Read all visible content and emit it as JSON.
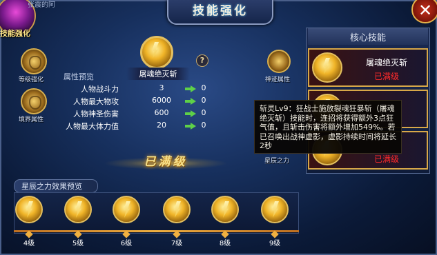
{
  "window": {
    "title": "技能强化",
    "top_left_text": "张震的阿",
    "close_label": "✕"
  },
  "portrait": {
    "label": "技能强化"
  },
  "left_menu": [
    {
      "label": "等级强化"
    },
    {
      "label": "境界属性"
    }
  ],
  "right_menu": [
    {
      "label": "神迹属性"
    },
    {
      "label": "星辰之力"
    }
  ],
  "skill": {
    "name": "屠魂绝灭斩",
    "help": "?",
    "attr_title": "属性预览",
    "stats": [
      {
        "name": "人物战斗力",
        "current": "3",
        "next": "0"
      },
      {
        "name": "人物最大物攻",
        "current": "6000",
        "next": "0"
      },
      {
        "name": "人物神圣伤害",
        "current": "600",
        "next": "0"
      },
      {
        "name": "人物最大体力值",
        "current": "20",
        "next": "0"
      }
    ],
    "maxed_label": "已满级"
  },
  "core_skills": {
    "title": "核心技能",
    "items": [
      {
        "name": "屠魂绝灭斩",
        "status": "已满级"
      },
      {
        "name": "",
        "status": ""
      },
      {
        "name": "",
        "status": "已满级"
      }
    ]
  },
  "tooltip": {
    "text": "斩灵Lv9：狂战士施放裂魂狂暴斩（屠魂绝灭斩）技能时，连招将获得额外3点狂气值，且斩击伤害将额外增加549%。若已召唤出战神虚影，虚影持续时间将延长2秒"
  },
  "star_power": {
    "title": "星辰之力效果预览",
    "levels": [
      "4级",
      "5级",
      "6级",
      "7级",
      "8级",
      "9级"
    ]
  },
  "colors": {
    "accent": "#f0b428",
    "maxed_red": "#ff2a2a",
    "arrow_green": "#5ed048"
  }
}
